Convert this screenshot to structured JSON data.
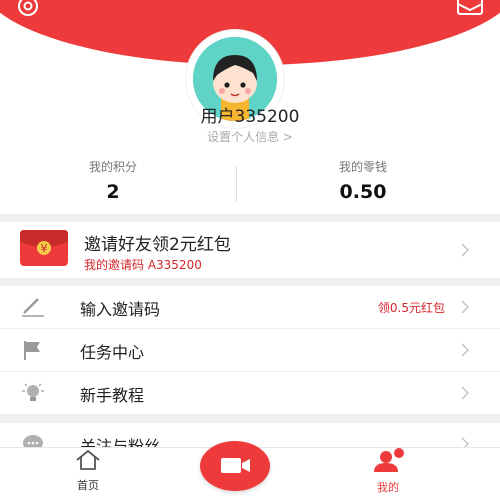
{
  "colors": {
    "accent": "#ee3a3a",
    "code_red": "#d7262b"
  },
  "header": {
    "settings_icon": "gear-icon",
    "message_icon": "envelope-icon"
  },
  "profile": {
    "username": "用户335200",
    "edit_link": "设置个人信息 >"
  },
  "stats": {
    "points_label": "我的积分",
    "points_value": "2",
    "balance_label": "我的零钱",
    "balance_value": "0.50"
  },
  "invite": {
    "title": "邀请好友领2元红包",
    "code_text": "我的邀请码 A335200",
    "icon_glyph": "¥"
  },
  "menu": {
    "items": [
      {
        "label": "输入邀请码",
        "extra": "领0.5元红包",
        "icon": "pencil-icon"
      },
      {
        "label": "任务中心",
        "icon": "flag-icon"
      },
      {
        "label": "新手教程",
        "icon": "lightbulb-icon"
      },
      {
        "label": "关注与粉丝",
        "icon": "chat-bubble-icon"
      }
    ]
  },
  "tabbar": {
    "home_label": "首页",
    "mine_label": "我的",
    "record_icon": "video-camera-icon"
  }
}
